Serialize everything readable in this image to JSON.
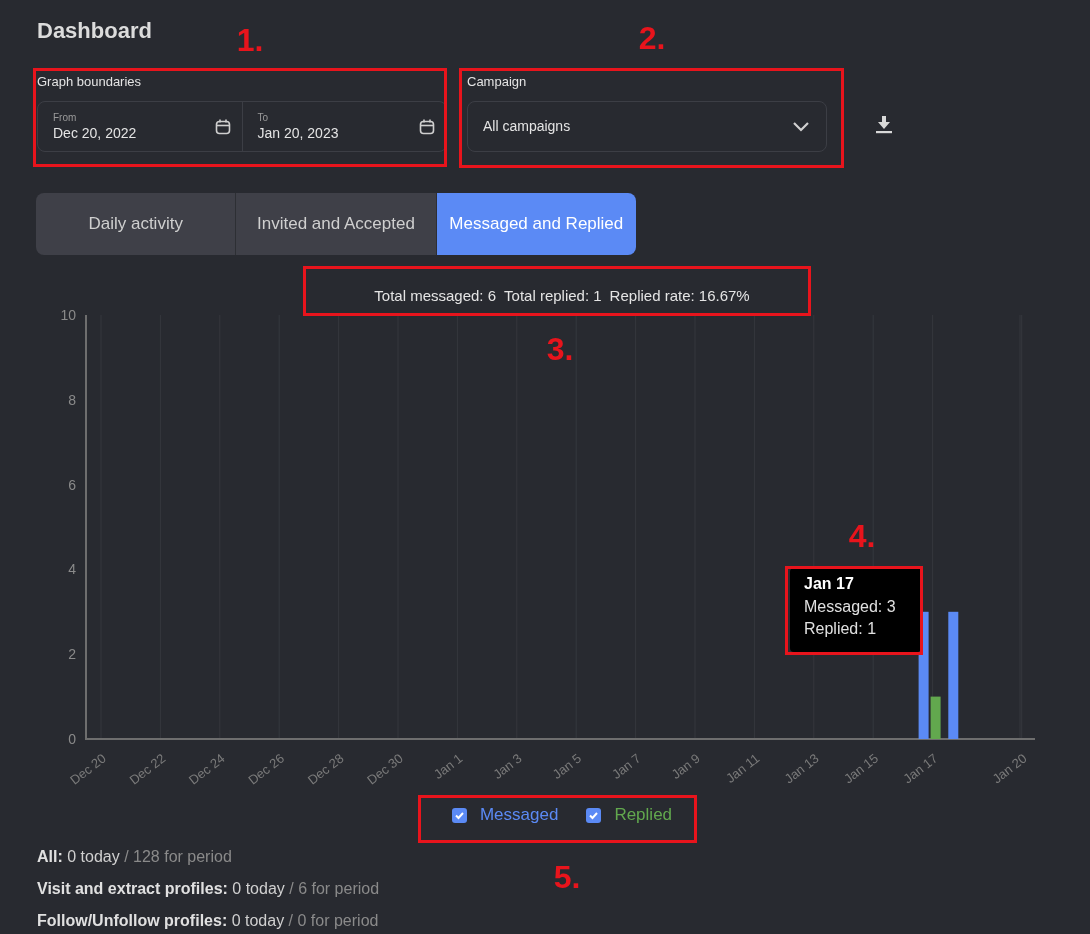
{
  "title": "Dashboard",
  "graph_boundaries": {
    "label": "Graph boundaries",
    "from": {
      "label": "From",
      "value": "Dec 20, 2022"
    },
    "to": {
      "label": "To",
      "value": "Jan 20, 2023"
    }
  },
  "campaign": {
    "label": "Campaign",
    "value": "All campaigns"
  },
  "tabs": [
    {
      "label": "Daily activity",
      "selected": false
    },
    {
      "label": "Invited and Accepted",
      "selected": false
    },
    {
      "label": "Messaged and Replied",
      "selected": true
    }
  ],
  "summary": [
    "Total messaged: 6",
    "Total replied: 1",
    "Replied rate: 16.67%"
  ],
  "chart": {
    "chart_data": {
      "type": "bar",
      "categories": [
        "Dec 20",
        null,
        "Dec 22",
        null,
        "Dec 24",
        null,
        "Dec 26",
        null,
        "Dec 28",
        null,
        "Dec 30",
        null,
        "Jan 1",
        null,
        "Jan 3",
        null,
        "Jan 5",
        null,
        "Jan 7",
        null,
        "Jan 9",
        null,
        "Jan 11",
        null,
        "Jan 13",
        null,
        "Jan 15",
        null,
        "Jan 17",
        null,
        null,
        "Jan 20"
      ],
      "series": [
        {
          "name": "Messaged",
          "color": "#5b8af5",
          "values": [
            0,
            0,
            0,
            0,
            0,
            0,
            0,
            0,
            0,
            0,
            0,
            0,
            0,
            0,
            0,
            0,
            0,
            0,
            0,
            0,
            0,
            0,
            0,
            0,
            0,
            0,
            0,
            0,
            3,
            3,
            0,
            0
          ]
        },
        {
          "name": "Replied",
          "color": "#62a84e",
          "values": [
            0,
            0,
            0,
            0,
            0,
            0,
            0,
            0,
            0,
            0,
            0,
            0,
            0,
            0,
            0,
            0,
            0,
            0,
            0,
            0,
            0,
            0,
            0,
            0,
            0,
            0,
            0,
            0,
            1,
            0,
            0,
            0
          ]
        }
      ],
      "ylim": [
        0,
        10
      ],
      "yticks": [
        0,
        2,
        4,
        6,
        8,
        10
      ]
    },
    "tooltip": {
      "title": "Jan 17",
      "lines": [
        "Messaged: 3",
        "Replied: 1"
      ]
    },
    "legend": [
      {
        "checked": true
      },
      {
        "checked": true
      }
    ]
  },
  "stats": [
    {
      "label": "All:",
      "today": "0 today",
      "period": "/ 128 for period"
    },
    {
      "label": "Visit and extract profiles:",
      "today": "0 today",
      "period": "/ 6 for period"
    },
    {
      "label": "Follow/Unfollow profiles:",
      "today": "0 today",
      "period": "/ 0 for period"
    }
  ],
  "annotations": [
    {
      "label": "1."
    },
    {
      "label": "2."
    },
    {
      "label": "3."
    },
    {
      "label": "4."
    },
    {
      "label": "5."
    }
  ]
}
